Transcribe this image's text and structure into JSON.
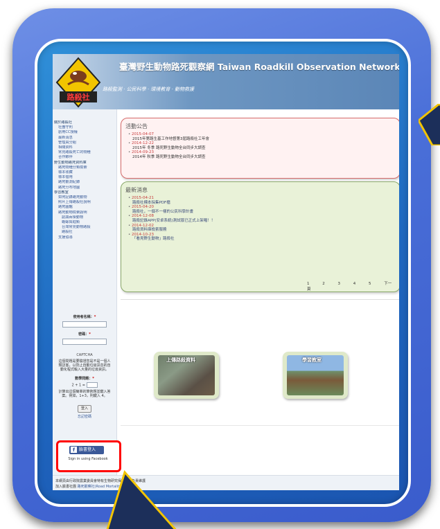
{
  "site": {
    "title": "臺灣野生動物路死觀察網 Taiwan Roadkill Observation Network",
    "subtitle": "路殺監測 · 公民科學 · 環境教育 · 動物救援",
    "logo_text": "路殺社"
  },
  "nav": [
    {
      "label": "關於路殺社",
      "level": 1
    },
    {
      "label": "社團守則",
      "level": 2
    },
    {
      "label": "創用CC授權",
      "level": 2
    },
    {
      "label": "最新消息",
      "level": 2
    },
    {
      "label": "管理員分組",
      "level": 2
    },
    {
      "label": "相關資料",
      "level": 2
    },
    {
      "label": "常見路殺死亡的物種",
      "level": 2
    },
    {
      "label": "合作夥伴",
      "level": 2
    },
    {
      "label": "野生動物路死資料庫",
      "level": 1
    },
    {
      "label": "路死物種分類檢索",
      "level": 2
    },
    {
      "label": "標本收藏",
      "level": 2
    },
    {
      "label": "標本借用",
      "level": 2
    },
    {
      "label": "路死觀測紀錄",
      "level": 2
    },
    {
      "label": "路死分布地圖",
      "level": 2
    },
    {
      "label": "學習教室",
      "level": 1
    },
    {
      "label": "如何記錄路死動物",
      "level": 2
    },
    {
      "label": "照片上傳路殺社說明",
      "level": 2
    },
    {
      "label": "路死圖鑑",
      "level": 2
    },
    {
      "label": "路死動物檢索說明",
      "level": 2
    },
    {
      "label": "認識兩棲動物",
      "level": 3
    },
    {
      "label": "蟾蜍與蛙類",
      "level": 3
    },
    {
      "label": "台灣常見動物路殺",
      "level": 3
    },
    {
      "label": "路殺社",
      "level": 3
    },
    {
      "label": "支援協尋",
      "level": 2
    }
  ],
  "login": {
    "username_label": "使用者名稱：",
    "password_label": "密碼：",
    "required_mark": "*",
    "captcha_title": "CAPTCHA",
    "captcha_desc": "這個問題是要驗證您是不是一個人類訪客，以防止自動垃圾訊息的自動化程式輸入大量的垃圾資訊。",
    "math_label": "數學問題：",
    "math_question": "2 + 1 =",
    "math_desc": "計算出這個簡單的算術題並鍵入答案。例如，1+3，則鍵入 4。",
    "login_button": "登入",
    "forgot_link": "忘記密碼",
    "fb_button": "臉書登入",
    "fb_signin": "Sign in using Facebook"
  },
  "announcements": {
    "title": "活動公告",
    "items": [
      {
        "date": "2015-04-07",
        "desc": "2015年第路生基工作地督第3屆路殺社工年會"
      },
      {
        "date": "2014-12-22",
        "desc": "2015年 冬季 路死野生動物全台同步大調查"
      },
      {
        "date": "2014-09-23",
        "desc": "2014年 秋季 路死野生動物全台同步大調查"
      }
    ]
  },
  "news": {
    "title": "最新消息",
    "items": [
      {
        "date": "2015-04-21",
        "desc": "路殺社標本採集PDF檔"
      },
      {
        "date": "2015-04-20",
        "desc": "路殺社，一個不一樣的公民科學計畫"
      },
      {
        "date": "2014-12-08",
        "desc": "路殺記錄APP(安卓系統)測試版已正式上架囉！！"
      },
      {
        "date": "2014-12-02",
        "desc": "路殺資料庫檢索服務"
      },
      {
        "date": "2014-10-23",
        "desc": "「看見野生動物」路殺社"
      }
    ],
    "pager": [
      "1",
      "2",
      "3",
      "4",
      "5",
      "下一頁"
    ]
  },
  "tiles": [
    {
      "label": "上傳路殺資料"
    },
    {
      "label": "學習教室"
    }
  ],
  "footer": {
    "line1": "本網頁由行政院農業委員會特有生物研究保育中心負責維護",
    "line2_prefix": "加入臉書社團",
    "line2_link": "路死觀察社(Road Mortality)"
  }
}
